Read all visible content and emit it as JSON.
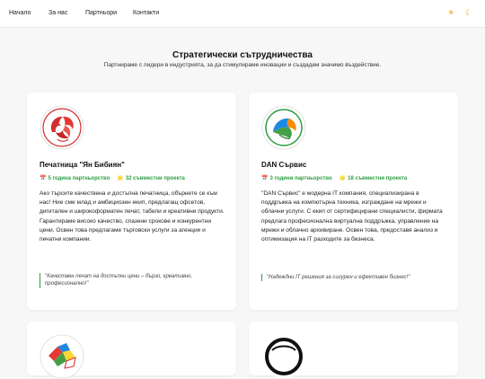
{
  "nav": {
    "items": [
      "Начало",
      "За нас",
      "Партньори",
      "Контакти"
    ]
  },
  "theme": {
    "light_icon": "sun-icon",
    "dark_icon": "moon-icon"
  },
  "hero": {
    "title": "Стратегически сътрудничества",
    "subtitle": "Партнираме с лидери в индустрията, за да стимулираме иновации и създадем значимо въздействие."
  },
  "colors": {
    "accent": "#2e9d42",
    "page_bg": "#f7f7f7",
    "card_bg": "#ffffff"
  },
  "partners": [
    {
      "name": "Печатница \"Ян Бибиян\"",
      "logo": "phoenix-logo",
      "years_icon": "calendar-icon",
      "years": "5 година партньорство",
      "projects_icon": "star-icon",
      "projects": "32 съвместни проекта",
      "description": "Ако търсите качествена и достъпна печатница, обърнете се към нас! Ние сме млад и амбициозен екип, предлагащ офсетов, дигитален и широкоформатен печат, табели и креативни продукти. Гарантираме високо качество, спазени срокове и конкурентни цени. Освен това предлагаме търговски услуги за агенции и печатни компании.",
      "quote": "\"Качествен печат на достъпни цени – бързо, креативно, професионално!\""
    },
    {
      "name": "DAN Сървис",
      "logo": "dan-service-logo",
      "years_icon": "calendar-icon",
      "years": "3 години партньорство",
      "projects_icon": "star-icon",
      "projects": "18 съвместни проекта",
      "description": "\"DAN Сървис\" е модерна IT компания, специализирана в поддръжка на компютърна техника, изграждане на мрежи и облачни услуги. С екип от сертифицирани специалисти, фирмата предлага професионална виртуална поддръжка, управление на мрежи и облачно архивиране. Освен това, предоставя анализ и оптимизация на IT разходите за бизнеса.",
      "quote": "\"Надеждни IT решения за сигурен и ефективен бизнес!\""
    },
    {
      "logo": "flags-globe-logo"
    },
    {
      "logo": "black-ring-logo"
    }
  ]
}
